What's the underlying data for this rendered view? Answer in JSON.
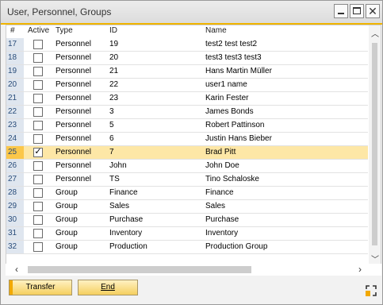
{
  "window": {
    "title": "User, Personnel, Groups"
  },
  "columns": {
    "num": "#",
    "active": "Active",
    "type": "Type",
    "id": "ID",
    "name": "Name"
  },
  "rows": [
    {
      "num": "17",
      "active": false,
      "type": "Personnel",
      "id": "19",
      "name": "test2 test test2"
    },
    {
      "num": "18",
      "active": false,
      "type": "Personnel",
      "id": "20",
      "name": "test3 test3 test3"
    },
    {
      "num": "19",
      "active": false,
      "type": "Personnel",
      "id": "21",
      "name": "Hans Martin Müller"
    },
    {
      "num": "20",
      "active": false,
      "type": "Personnel",
      "id": "22",
      "name": "user1 name"
    },
    {
      "num": "21",
      "active": false,
      "type": "Personnel",
      "id": "23",
      "name": "Karin Fester"
    },
    {
      "num": "22",
      "active": false,
      "type": "Personnel",
      "id": "3",
      "name": "James Bonds"
    },
    {
      "num": "23",
      "active": false,
      "type": "Personnel",
      "id": "5",
      "name": "Robert  Pattinson"
    },
    {
      "num": "24",
      "active": false,
      "type": "Personnel",
      "id": "6",
      "name": "Justin Hans Bieber"
    },
    {
      "num": "25",
      "active": true,
      "type": "Personnel",
      "id": "7",
      "name": "Brad  Pitt",
      "selected": true
    },
    {
      "num": "26",
      "active": false,
      "type": "Personnel",
      "id": "John",
      "name": "John Doe"
    },
    {
      "num": "27",
      "active": false,
      "type": "Personnel",
      "id": "TS",
      "name": "Tino Schaloske"
    },
    {
      "num": "28",
      "active": false,
      "type": "Group",
      "id": "Finance",
      "name": "Finance"
    },
    {
      "num": "29",
      "active": false,
      "type": "Group",
      "id": "Sales",
      "name": "Sales"
    },
    {
      "num": "30",
      "active": false,
      "type": "Group",
      "id": "Purchase",
      "name": "Purchase"
    },
    {
      "num": "31",
      "active": false,
      "type": "Group",
      "id": "Inventory",
      "name": "Inventory"
    },
    {
      "num": "32",
      "active": false,
      "type": "Group",
      "id": "Production",
      "name": "Production Group"
    }
  ],
  "buttons": {
    "transfer": "Transfer",
    "end": "End"
  },
  "icons": {
    "minimize": "minimize-icon",
    "maximize": "maximize-icon",
    "close": "close-icon",
    "corner": "form-settings-icon"
  },
  "colors": {
    "accent": "#f0b400",
    "selected_row": "#fde7a6",
    "rownum_bg": "#dfe6ef"
  }
}
